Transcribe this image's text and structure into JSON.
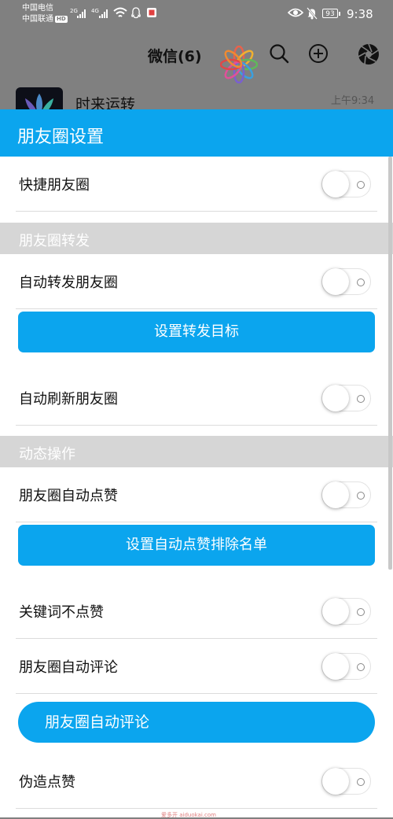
{
  "status_bar": {
    "carrier1": "中国电信",
    "carrier2": "中国联通",
    "hd": "HD",
    "net1": "2G",
    "net2": "4G",
    "battery": "93",
    "time": "9:38"
  },
  "header": {
    "title": "微信(6)",
    "icons": [
      "search-icon",
      "plus-icon",
      "aperture-icon",
      "flower-logo-icon"
    ]
  },
  "chat_preview": {
    "name": "时来运转",
    "time": "上午9:34"
  },
  "panel": {
    "title": "朋友圈设置",
    "items": [
      {
        "kind": "toggle",
        "label": "快捷朋友圈",
        "on": false
      },
      {
        "kind": "section",
        "label": "朋友圈转发"
      },
      {
        "kind": "toggle",
        "label": "自动转发朋友圈",
        "on": false
      },
      {
        "kind": "button",
        "label": "设置转发目标"
      },
      {
        "kind": "toggle",
        "label": "自动刷新朋友圈",
        "on": false
      },
      {
        "kind": "section",
        "label": "动态操作"
      },
      {
        "kind": "toggle",
        "label": "朋友圈自动点赞",
        "on": false
      },
      {
        "kind": "button",
        "label": "设置自动点赞排除名单"
      },
      {
        "kind": "toggle",
        "label": "关键词不点赞",
        "on": false
      },
      {
        "kind": "toggle",
        "label": "朋友圈自动评论",
        "on": false
      },
      {
        "kind": "button",
        "label": "朋友圈自动评论",
        "style": "pill"
      },
      {
        "kind": "toggle",
        "label": "伪造点赞",
        "on": false
      }
    ]
  },
  "watermark": "爱多开 aiduokai.com",
  "colors": {
    "accent": "#0ba5ee",
    "section_bg": "#d6d6d6",
    "dim_overlay": "#808080"
  }
}
